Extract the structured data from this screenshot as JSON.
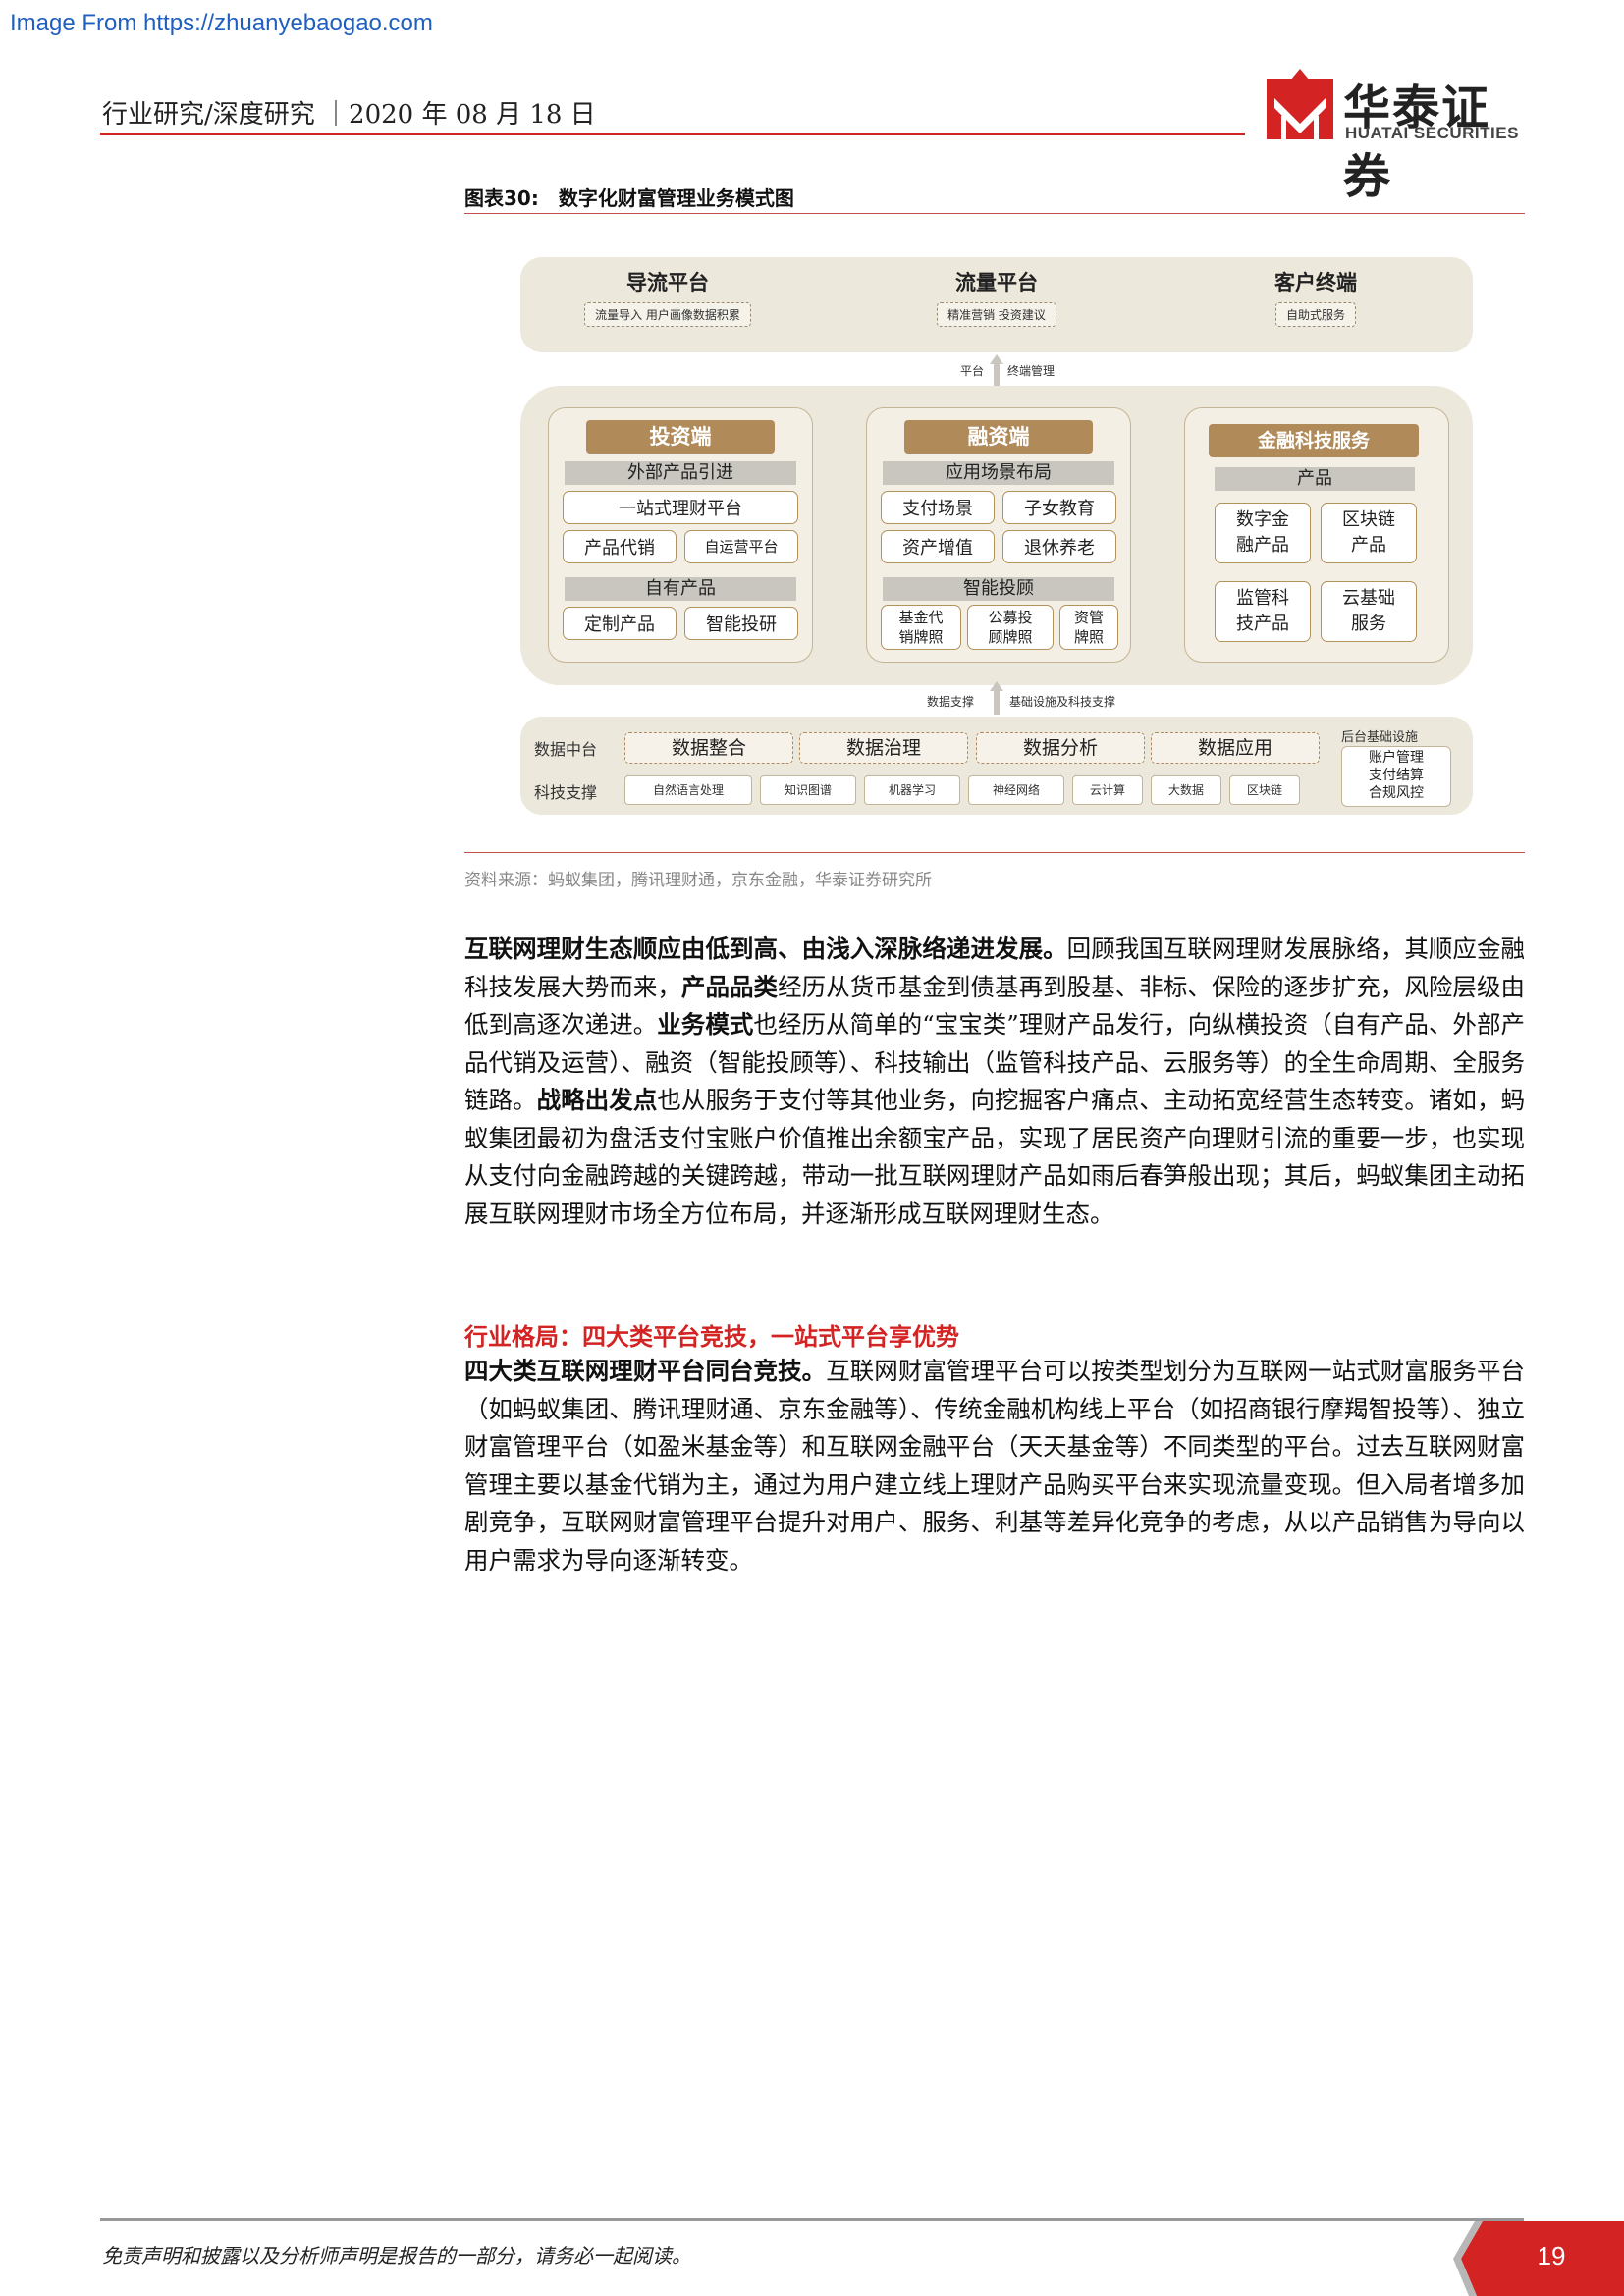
{
  "watermark": "Image From https://zhuanyebaogao.com",
  "header": {
    "left_text": "行业研究/深度研究 ｜2020 年 08 月 18 日",
    "logo_cn": "华泰证券",
    "logo_en": "HUATAI SECURITIES"
  },
  "figure": {
    "title": "图表30:　数字化财富管理业务模式图",
    "source": "资料来源：蚂蚁集团，腾讯理财通，京东金融，华泰证券研究所",
    "top": [
      {
        "title": "导流平台",
        "desc": "流量导入 用户画像数据积累"
      },
      {
        "title": "流量平台",
        "desc": "精准营销 投资建议"
      },
      {
        "title": "客户终端",
        "desc": "自助式服务"
      }
    ],
    "arrow1": {
      "left": "平台",
      "right": "终端管理"
    },
    "invest": {
      "title": "投资端",
      "sub1": "外部产品引进",
      "one_stop": "一站式理财平台",
      "agency": "产品代销",
      "self_op": "自运营平台",
      "sub2": "自有产品",
      "custom": "定制产品",
      "smart": "智能投研"
    },
    "finance": {
      "title": "融资端",
      "sub1": "应用场景布局",
      "items": [
        "支付场景",
        "子女教育",
        "资产增值",
        "退休养老"
      ],
      "sub2": "智能投顾",
      "licenses": [
        "基金代\n销牌照",
        "公募投\n顾牌照",
        "资管\n牌照"
      ]
    },
    "fintech": {
      "title": "金融科技服务",
      "sub": "产品",
      "items": [
        "数字金\n融产品",
        "区块链\n产品",
        "监管科\n技产品",
        "云基础\n服务"
      ]
    },
    "arrow2": {
      "left": "数据支撑",
      "right": "基础设施及科技支撑"
    },
    "bottom": {
      "row1_label": "数据中台",
      "row1": [
        "数据整合",
        "数据治理",
        "数据分析",
        "数据应用"
      ],
      "row2_label": "科技支撑",
      "row2": [
        "自然语言处理",
        "知识图谱",
        "机器学习",
        "神经网络",
        "云计算",
        "大数据",
        "区块链"
      ],
      "infra_title": "后台基础设施",
      "infra": "账户管理\n支付结算\n合规风控"
    }
  },
  "para1": {
    "b1": "互联网理财生态顺应由低到高、由浅入深脉络递进发展。",
    "t1": "回顾我国互联网理财发展脉络，其顺应金融科技发展大势而来，",
    "b2": "产品品类",
    "t2": "经历从货币基金到债基再到股基、非标、保险的逐步扩充，风险层级由低到高逐次递进。",
    "b3": "业务模式",
    "t3": "也经历从简单的“宝宝类”理财产品发行，向纵横投资（自有产品、外部产品代销及运营）、融资（智能投顾等）、科技输出（监管科技产品、云服务等）的全生命周期、全服务链路。",
    "b4": "战略出发点",
    "t4": "也从服务于支付等其他业务，向挖掘客户痛点、主动拓宽经营生态转变。诸如，蚂蚁集团最初为盘活支付宝账户价值推出余额宝产品，实现了居民资产向理财引流的重要一步，也实现从支付向金融跨越的关键跨越，带动一批互联网理财产品如雨后春笋般出现；其后，蚂蚁集团主动拓展互联网理财市场全方位布局，并逐渐形成互联网理财生态。"
  },
  "section_title": "行业格局：四大类平台竞技，一站式平台享优势",
  "para2": {
    "b1": "四大类互联网理财平台同台竞技。",
    "t1": "互联网财富管理平台可以按类型划分为互联网一站式财富服务平台（如蚂蚁集团、腾讯理财通、京东金融等）、传统金融机构线上平台（如招商银行摩羯智投等）、独立财富管理平台（如盈米基金等）和互联网金融平台（天天基金等）不同类型的平台。过去互联网财富管理主要以基金代销为主，通过为用户建立线上理财产品购买平台来实现流量变现。但入局者增多加剧竞争，互联网财富管理平台提升对用户、服务、利基等差异化竞争的考虑，从以产品销售为导向以用户需求为导向逐渐转变。"
  },
  "footer": {
    "disclaimer": "免责声明和披露以及分析师声明是报告的一部分，请务必一起阅读。",
    "page": "19"
  },
  "colors": {
    "accent_red": "#d32323",
    "diagram_bg": "#ede8dc",
    "brown": "#b18a5a"
  }
}
